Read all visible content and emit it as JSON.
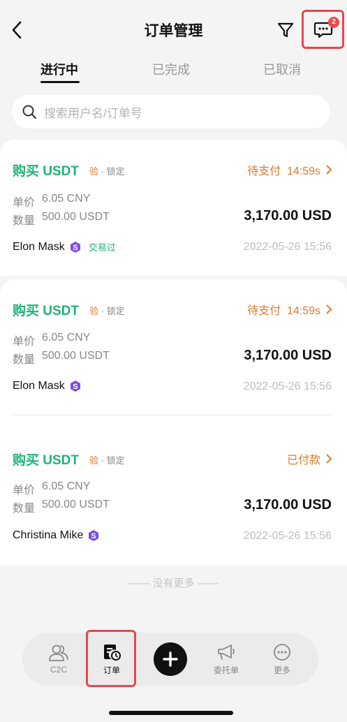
{
  "header": {
    "title": "订单管理",
    "message_badge": "2"
  },
  "tabs": [
    {
      "label": "进行中",
      "active": true
    },
    {
      "label": "已完成",
      "active": false
    },
    {
      "label": "已取消",
      "active": false
    }
  ],
  "search": {
    "placeholder": "搜索用户名/订单号"
  },
  "orders": [
    {
      "title": "购买 USDT",
      "tag_verify": "验",
      "tag_sep": "·",
      "tag_lock": "锁定",
      "status": "待支付  14:59s",
      "price_label": "单价",
      "price": "6.05 CNY",
      "qty_label": "数量",
      "qty": "500.00 USDT",
      "amount": "3,170.00 USD",
      "user": "Elon Mask",
      "traded": "交易过",
      "date": "2022-05-26 15:56"
    },
    {
      "title": "购买 USDT",
      "tag_verify": "验",
      "tag_sep": "·",
      "tag_lock": "锁定",
      "status": "待支付  14:59s",
      "price_label": "单价",
      "price": "6.05 CNY",
      "qty_label": "数量",
      "qty": "500.00 USDT",
      "amount": "3,170.00 USD",
      "user": "Elon Mask",
      "date": "2022-05-26 15:56"
    },
    {
      "title": "购买 USDT",
      "tag_verify": "验",
      "tag_sep": "·",
      "tag_lock": "锁定",
      "status": "已付款",
      "price_label": "单价",
      "price": "6.05 CNY",
      "qty_label": "数量",
      "qty": "500.00 USDT",
      "amount": "3,170.00 USD",
      "user": "Christina Mike",
      "date": "2022-05-26 15:56"
    }
  ],
  "no_more": "—— 没有更多 ——",
  "bottom_nav": [
    {
      "label": "C2C",
      "icon": "people-icon"
    },
    {
      "label": "订单",
      "icon": "order-clock-icon",
      "active": true
    },
    {
      "label": "",
      "icon": "plus-icon"
    },
    {
      "label": "委托单",
      "icon": "megaphone-icon"
    },
    {
      "label": "更多",
      "icon": "more-icon"
    }
  ],
  "colors": {
    "buy_green": "#20b377",
    "status_orange": "#e07a2c",
    "highlight_red": "#e5484d"
  }
}
